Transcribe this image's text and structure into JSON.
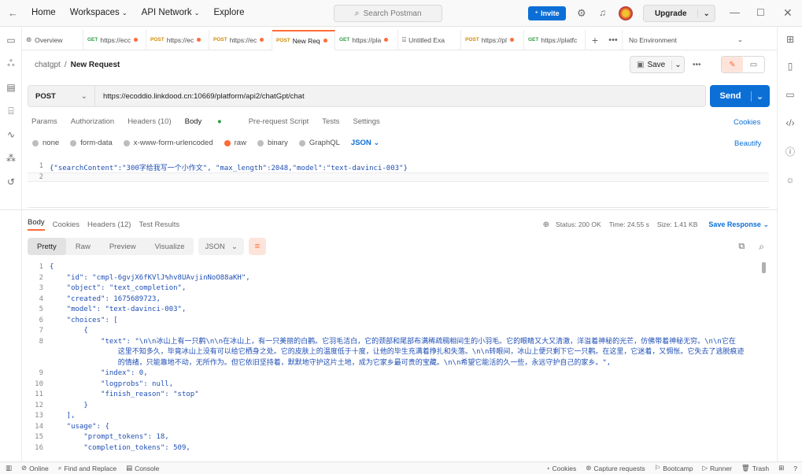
{
  "topbar": {
    "nav": [
      "Home",
      "Workspaces",
      "API Network",
      "Explore"
    ],
    "search_placeholder": "Search Postman",
    "invite_label": "Invite",
    "upgrade_label": "Upgrade"
  },
  "tabs": [
    {
      "icon": "overview-icon",
      "method": "",
      "label": "Overview",
      "dot": false
    },
    {
      "method": "GET",
      "label": "https://ecc",
      "dot": true
    },
    {
      "method": "POST",
      "label": "https://ec",
      "dot": true
    },
    {
      "method": "POST",
      "label": "https://ec",
      "dot": true
    },
    {
      "method": "POST",
      "label": "New Req",
      "dot": true,
      "active": true
    },
    {
      "method": "GET",
      "label": "https://pla",
      "dot": true
    },
    {
      "icon": "doc-icon",
      "method": "",
      "label": "Untitled Exa",
      "dot": false
    },
    {
      "method": "POST",
      "label": "https://pl",
      "dot": true
    },
    {
      "method": "GET",
      "label": "https://platfc",
      "dot": false
    }
  ],
  "environment": "No Environment",
  "breadcrumb": {
    "collection": "chatgpt",
    "separator": "/",
    "request": "New Request"
  },
  "save_label": "Save",
  "request": {
    "method": "POST",
    "url": "https://ecoddio.linkdood.cn:10669/platform/api2/chatGpt/chat",
    "send_label": "Send",
    "tabs": [
      "Params",
      "Authorization",
      "Headers (10)",
      "Body",
      "Pre-request Script",
      "Tests",
      "Settings"
    ],
    "cookies_label": "Cookies",
    "body_types": [
      "none",
      "form-data",
      "x-www-form-urlencoded",
      "raw",
      "binary",
      "GraphQL"
    ],
    "body_format": "JSON",
    "beautify_label": "Beautify",
    "body_lines": [
      {
        "n": "1",
        "text": "{\"searchContent\":\"300字给我写一个小作文\", \"max_length\":2048,\"model\":\"text-davinci-003\"}"
      },
      {
        "n": "2",
        "text": ""
      }
    ]
  },
  "response": {
    "tabs": [
      "Body",
      "Cookies",
      "Headers (12)",
      "Test Results"
    ],
    "status": "Status: 200 OK",
    "time": "Time: 24.55 s",
    "size": "Size: 1.41 KB",
    "save_response": "Save Response",
    "views": [
      "Pretty",
      "Raw",
      "Preview",
      "Visualize"
    ],
    "format": "JSON",
    "lines": [
      {
        "n": "1",
        "text": "{"
      },
      {
        "n": "2",
        "text": "    \"id\": \"cmpl-6gvjX6fKVlJ%hv8UAvjinNoO88aKH\","
      },
      {
        "n": "3",
        "text": "    \"object\": \"text_completion\","
      },
      {
        "n": "4",
        "text": "    \"created\": 1675689723,"
      },
      {
        "n": "5",
        "text": "    \"model\": \"text-davinci-003\","
      },
      {
        "n": "6",
        "text": "    \"choices\": ["
      },
      {
        "n": "7",
        "text": "        {"
      },
      {
        "n": "8",
        "text": "            \"text\": \"\\n\\n冰山上有一只鹳\\n\\n在冰山上，有一只美丽的白鹳。它羽毛洁白，它的颈部和尾部布满稀疏稠相间生的小羽毛。它的眼睛又大又清澈，洋溢着神秘的光芒，仿佛带着神秘无穷。\\n\\n它在"
      },
      {
        "n": "",
        "text": "                这里不知多久，毕竟冰山上没有可以给它栖身之处。它的皮肤上的温度低于十度，让他的毕生充满着挣扎和失落。\\n\\n转眼间，冰山上便只剩下它一只鹳。在这里，它迷着，又惆怅。它失去了逃脱痕迹"
      },
      {
        "n": "",
        "text": "                的情绪，只能靠地不动，无所作为。但它依旧坚持着，默默地守护这片土地，成为它家乡最可贵的宝藏。\\n\\n希望它能活的久一些，永远守护自己的家乡。\","
      },
      {
        "n": "9",
        "text": "            \"index\": 0,"
      },
      {
        "n": "10",
        "text": "            \"logprobs\": null,"
      },
      {
        "n": "11",
        "text": "            \"finish_reason\": \"stop\""
      },
      {
        "n": "12",
        "text": "        }"
      },
      {
        "n": "13",
        "text": "    ],"
      },
      {
        "n": "14",
        "text": "    \"usage\": {"
      },
      {
        "n": "15",
        "text": "        \"prompt_tokens\": 18,"
      },
      {
        "n": "16",
        "text": "        \"completion_tokens\": 509,"
      }
    ]
  },
  "statusbar": {
    "left": [
      "Online",
      "Find and Replace",
      "Console"
    ],
    "right": [
      "Cookies",
      "Capture requests",
      "Bootcamp",
      "Runner",
      "Trash"
    ]
  },
  "colors": {
    "accent": "#ff6c37",
    "primary": "#0c6fd6"
  }
}
